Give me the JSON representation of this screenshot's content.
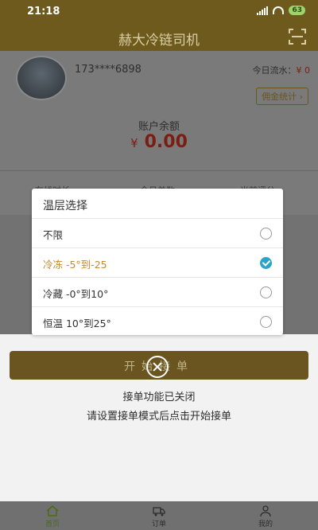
{
  "status": {
    "time": "21:18",
    "battery": "63"
  },
  "header": {
    "title": "赫大冷链司机"
  },
  "profile": {
    "phone": "173****6898",
    "flow_label": "今日流水：",
    "flow_value": "¥ 0",
    "commission_button": "佣金统计",
    "balance_label": "账户余额",
    "balance_currency": "¥",
    "balance_value": "0.00"
  },
  "stats": {
    "online": "在线时长",
    "orders": "今日单数",
    "rating": "当前评分"
  },
  "modal": {
    "title": "温层选择",
    "options": [
      {
        "label": "不限",
        "selected": false
      },
      {
        "label": "冷冻 -5°到-25",
        "selected": true
      },
      {
        "label": "冷藏 -0°到10°",
        "selected": false
      },
      {
        "label": "恒温 10°到25°",
        "selected": false
      }
    ]
  },
  "main": {
    "start_button": "开始接单",
    "notice_line1": "接单功能已关闭",
    "notice_line2": "请设置接单模式后点击开始接单"
  },
  "tabbar": {
    "home": "首页",
    "orders": "订单",
    "mine": "我的"
  },
  "colors": {
    "header": "#6e5a1c",
    "accent_selected": "#c58a2a",
    "radio_checked": "#2aa4c9"
  }
}
